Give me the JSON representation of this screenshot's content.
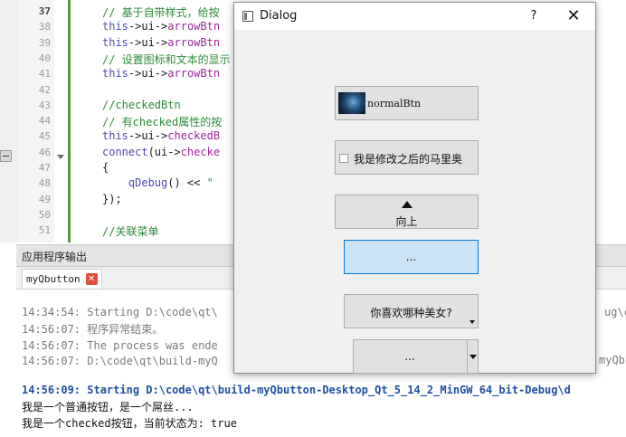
{
  "editor": {
    "line_numbers": [
      "37",
      "38",
      "39",
      "40",
      "41",
      "42",
      "43",
      "44",
      "45",
      "46",
      "47",
      "48",
      "49",
      "50",
      "51"
    ],
    "current_line": "37",
    "lines": [
      {
        "kind": "comment",
        "text": "// 基于自带样式，给按"
      },
      {
        "kind": "ptr",
        "a": "this",
        "b": "->ui->",
        "c": "arrowBtn"
      },
      {
        "kind": "ptr",
        "a": "this",
        "b": "->ui->",
        "c": "arrowBtn"
      },
      {
        "kind": "comment",
        "text": "// 设置图标和文本的显示"
      },
      {
        "kind": "ptr",
        "a": "this",
        "b": "->ui->",
        "c": "arrowBtn"
      },
      {
        "kind": "blank",
        "text": ""
      },
      {
        "kind": "comment",
        "text": "//checkedBtn"
      },
      {
        "kind": "comment",
        "text": "// 有checked属性的按"
      },
      {
        "kind": "ptr",
        "a": "this",
        "b": "->ui->",
        "c": "checkedB"
      },
      {
        "kind": "connect",
        "a": "connect",
        "b": "(ui->",
        "c": "checke"
      },
      {
        "kind": "plain",
        "text": "{"
      },
      {
        "kind": "debug",
        "a": "    qDebug",
        "b": "() << ",
        "c": "\""
      },
      {
        "kind": "plain",
        "text": "});"
      },
      {
        "kind": "blank",
        "text": ""
      },
      {
        "kind": "comment",
        "text": "//关联菜单"
      }
    ]
  },
  "panel": {
    "title": "应用程序输出",
    "tab_label": "myQbutton",
    "tab_close": "✕"
  },
  "output": {
    "lines": [
      {
        "style": "gray",
        "text": "14:34:54: Starting D:\\code\\qt\\"
      },
      {
        "style": "gray",
        "text": "14:56:07: 程序异常结束。"
      },
      {
        "style": "gray",
        "text": "14:56:07: The process was ende"
      },
      {
        "style": "gray",
        "text": "14:56:07: D:\\code\\qt\\build-myQ"
      },
      {
        "style": "blue",
        "text": "14:56:09: Starting D:\\code\\qt\\build-myQbutton-Desktop_Qt_5_14_2_MinGW_64_bit-Debug\\d"
      },
      {
        "style": "black",
        "text": "我是一个普通按钮，是一个屌丝..."
      },
      {
        "style": "black",
        "text": "我是一个checked按钮，当前状态为: true"
      }
    ],
    "right_fragments": [
      "ug\\c",
      "myQb"
    ]
  },
  "dialog": {
    "title": "Dialog",
    "help": "?",
    "close": "✕",
    "normal_btn": "normalBtn",
    "checked_btn": "我是修改之后的马里奥",
    "up_btn": "向上",
    "focus_btn": "...",
    "menu_btn": "你喜欢哪种美女?",
    "split_btn": "..."
  }
}
